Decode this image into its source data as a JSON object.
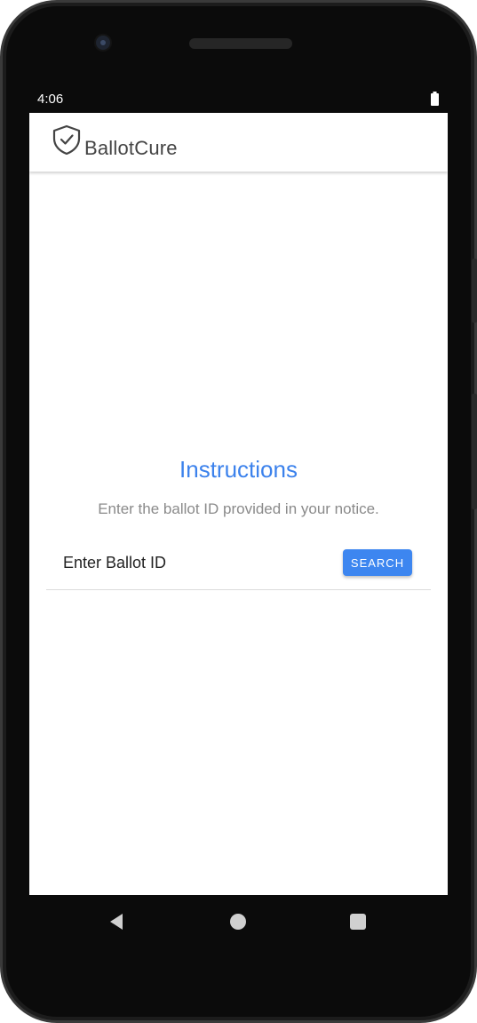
{
  "status_bar": {
    "time": "4:06",
    "battery_icon": "battery-full-icon"
  },
  "app_bar": {
    "logo_icon": "shield-check-icon",
    "title": "BallotCure"
  },
  "main": {
    "instructions_title": "Instructions",
    "instructions_text": "Enter the ballot ID provided in your notice.",
    "ballot_input": {
      "placeholder": "Enter Ballot ID",
      "value": ""
    },
    "search_button_label": "SEARCH"
  },
  "nav_bar": {
    "back_icon": "back-triangle-icon",
    "home_icon": "home-circle-icon",
    "recents_icon": "recents-square-icon"
  },
  "colors": {
    "accent": "#3c82ec",
    "button": "#3d86f0",
    "muted_text": "#8a8a8a",
    "device_frame": "#0b0b0b"
  }
}
